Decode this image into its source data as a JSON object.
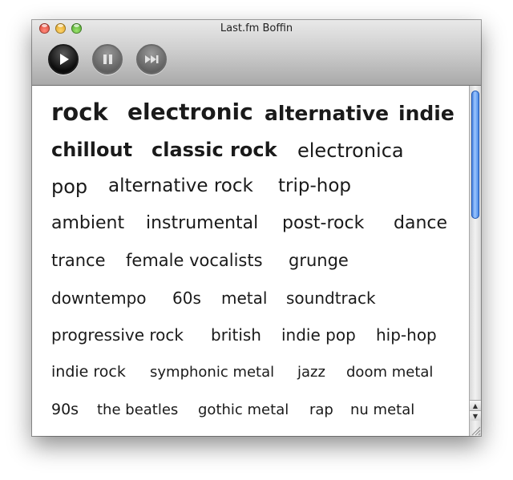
{
  "window": {
    "title": "Last.fm Boffin"
  },
  "toolbar": {
    "buttons": [
      {
        "name": "play",
        "icon": "play-icon"
      },
      {
        "name": "pause",
        "icon": "pause-icon"
      },
      {
        "name": "skip",
        "icon": "skip-forward-icon"
      }
    ]
  },
  "tags": [
    {
      "label": "rock",
      "weight": "bold"
    },
    {
      "label": "electronic",
      "weight": "bold"
    },
    {
      "label": "alternative",
      "weight": "bold"
    },
    {
      "label": "indie",
      "weight": "bold"
    },
    {
      "label": "chillout",
      "weight": "bold"
    },
    {
      "label": "classic rock",
      "weight": "bold"
    },
    {
      "label": "electronica",
      "weight": "normal"
    },
    {
      "label": "pop",
      "weight": "normal"
    },
    {
      "label": "alternative rock",
      "weight": "normal"
    },
    {
      "label": "trip-hop",
      "weight": "normal"
    },
    {
      "label": "ambient",
      "weight": "normal"
    },
    {
      "label": "instrumental",
      "weight": "normal"
    },
    {
      "label": "post-rock",
      "weight": "normal"
    },
    {
      "label": "dance",
      "weight": "normal"
    },
    {
      "label": "trance",
      "weight": "normal"
    },
    {
      "label": "female vocalists",
      "weight": "normal"
    },
    {
      "label": "grunge",
      "weight": "normal"
    },
    {
      "label": "downtempo",
      "weight": "normal"
    },
    {
      "label": "60s",
      "weight": "normal"
    },
    {
      "label": "metal",
      "weight": "normal"
    },
    {
      "label": "soundtrack",
      "weight": "normal"
    },
    {
      "label": "progressive rock",
      "weight": "normal"
    },
    {
      "label": "british",
      "weight": "normal"
    },
    {
      "label": "indie pop",
      "weight": "normal"
    },
    {
      "label": "hip-hop",
      "weight": "normal"
    },
    {
      "label": "indie rock",
      "weight": "normal"
    },
    {
      "label": "symphonic metal",
      "weight": "normal"
    },
    {
      "label": "jazz",
      "weight": "normal"
    },
    {
      "label": "doom metal",
      "weight": "normal"
    },
    {
      "label": "90s",
      "weight": "normal"
    },
    {
      "label": "the beatles",
      "weight": "normal"
    },
    {
      "label": "gothic metal",
      "weight": "normal"
    },
    {
      "label": "rap",
      "weight": "normal"
    },
    {
      "label": "nu metal",
      "weight": "normal"
    }
  ],
  "scrollbar": {
    "up_arrow": "▲",
    "down_arrow": "▼"
  },
  "colors": {
    "accent": "#3a7ee4",
    "text": "#1a1a1a"
  }
}
